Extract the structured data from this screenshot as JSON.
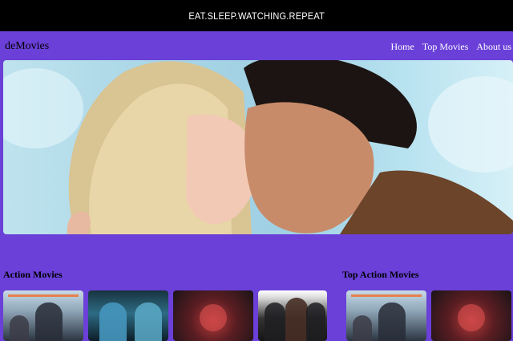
{
  "topbar": {
    "slogan": "EAT.SLEEP.WATCHING.REPEAT"
  },
  "navbar": {
    "brand": "deMovies",
    "links": [
      "Home",
      "Top Movies",
      "About us"
    ]
  },
  "sections": {
    "action": {
      "title": "Action Movies"
    },
    "top_action": {
      "title": "Top Action Movies"
    }
  },
  "colors": {
    "page_bg": "#6a40d8",
    "topbar_bg": "#000000"
  }
}
